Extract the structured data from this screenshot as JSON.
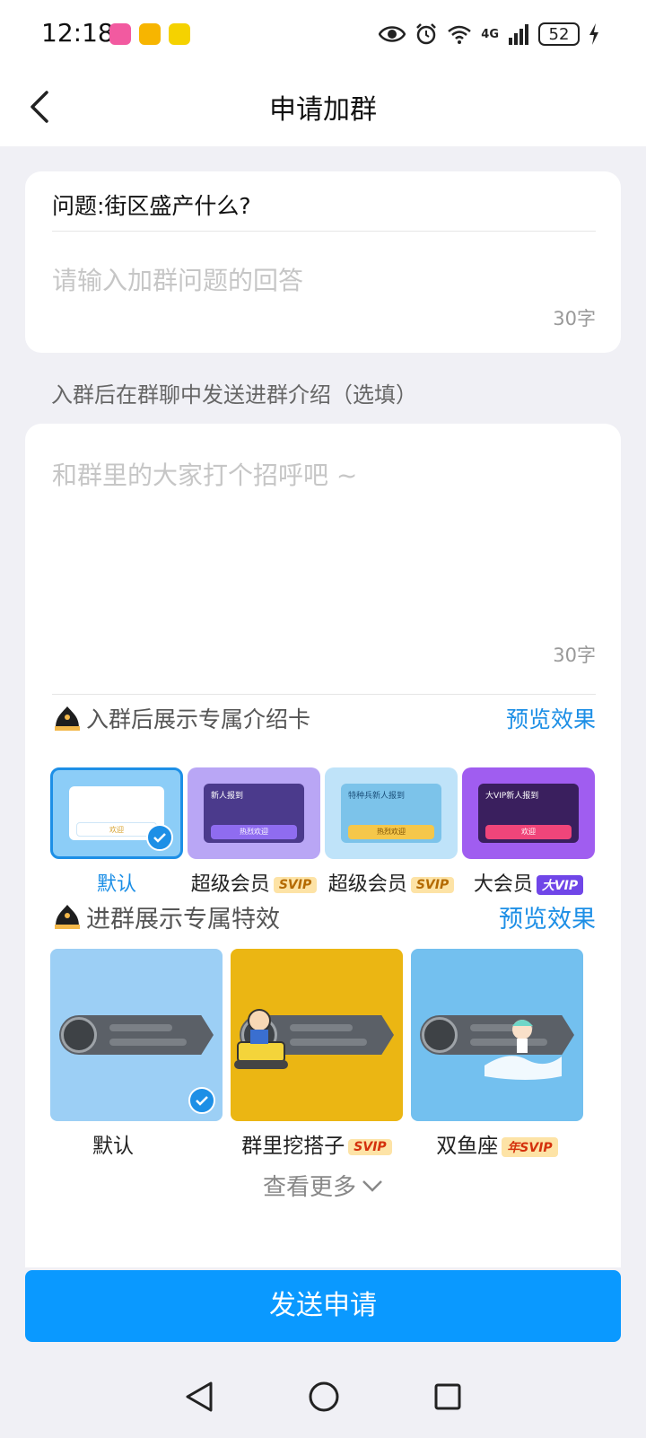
{
  "status_bar": {
    "time": "12:18",
    "battery": "52",
    "network": "4G"
  },
  "navbar": {
    "title": "申请加群"
  },
  "question_card": {
    "question": "问题:街区盛产什么?",
    "answer_placeholder": "请输入加群问题的回答",
    "counter": "30字"
  },
  "intro_hint": "入群后在群聊中发送进群介绍（选填）",
  "intro_card": {
    "placeholder": "和群里的大家打个招呼吧 ~",
    "counter": "30字"
  },
  "intro_cards_section": {
    "title": "入群后展示专属介绍卡",
    "preview": "预览效果",
    "items": [
      {
        "label": "默认",
        "badge": "",
        "selected": true,
        "button_text": "欢迎",
        "top_text": ""
      },
      {
        "label": "超级会员",
        "badge": "SVIP",
        "selected": false,
        "button_text": "热烈欢迎",
        "top_text": "新人报到"
      },
      {
        "label": "超级会员",
        "badge": "SVIP",
        "selected": false,
        "button_text": "热烈欢迎",
        "top_text": "特种兵新人报到"
      },
      {
        "label": "大会员",
        "badge": "大VIP",
        "selected": false,
        "button_text": "欢迎",
        "top_text": "大VIP新人报到"
      }
    ]
  },
  "effects_section": {
    "title": "进群展示专属特效",
    "preview": "预览效果",
    "items": [
      {
        "label": "默认",
        "badge": "",
        "selected": true
      },
      {
        "label": "群里挖搭子",
        "badge": "SVIP",
        "selected": false
      },
      {
        "label": "双鱼座",
        "badge": "年SVIP",
        "selected": false
      }
    ],
    "see_more": "查看更多"
  },
  "submit_label": "发送申请",
  "colors": {
    "accent": "#1d8fe6",
    "button": "#0a99ff",
    "background": "#f0f0f5"
  }
}
